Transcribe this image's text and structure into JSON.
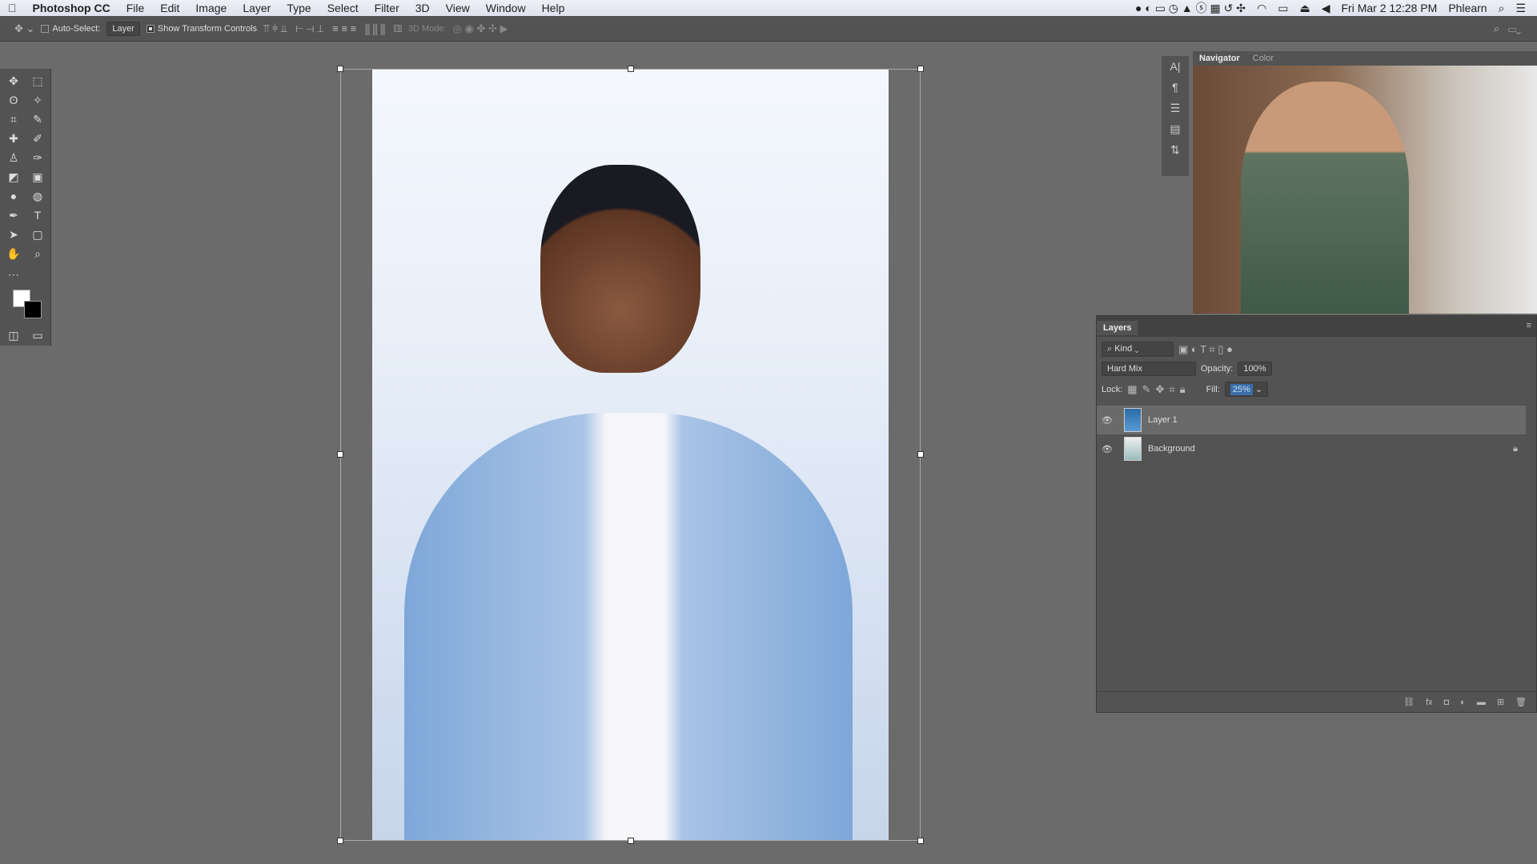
{
  "menubar": {
    "app": "Photoshop CC",
    "items": [
      "File",
      "Edit",
      "Image",
      "Layer",
      "Type",
      "Select",
      "Filter",
      "3D",
      "View",
      "Window",
      "Help"
    ],
    "clock": "Fri Mar 2  12:28 PM",
    "user": "Phlearn"
  },
  "options": {
    "auto_select_label": "Auto-Select:",
    "auto_select_value": "Layer",
    "show_transform": "Show Transform Controls",
    "mode_3d": "3D Mode:"
  },
  "navigator": {
    "tabs": [
      "Navigator",
      "Color"
    ]
  },
  "layers": {
    "title": "Layers",
    "filter_kind": "Kind",
    "blend_mode": "Hard Mix",
    "opacity_label": "Opacity:",
    "opacity": "100%",
    "lock_label": "Lock:",
    "fill_label": "Fill:",
    "fill": "25%",
    "items": [
      {
        "name": "Layer 1",
        "visible": true,
        "selected": true
      },
      {
        "name": "Background",
        "visible": true,
        "locked": true
      }
    ]
  }
}
